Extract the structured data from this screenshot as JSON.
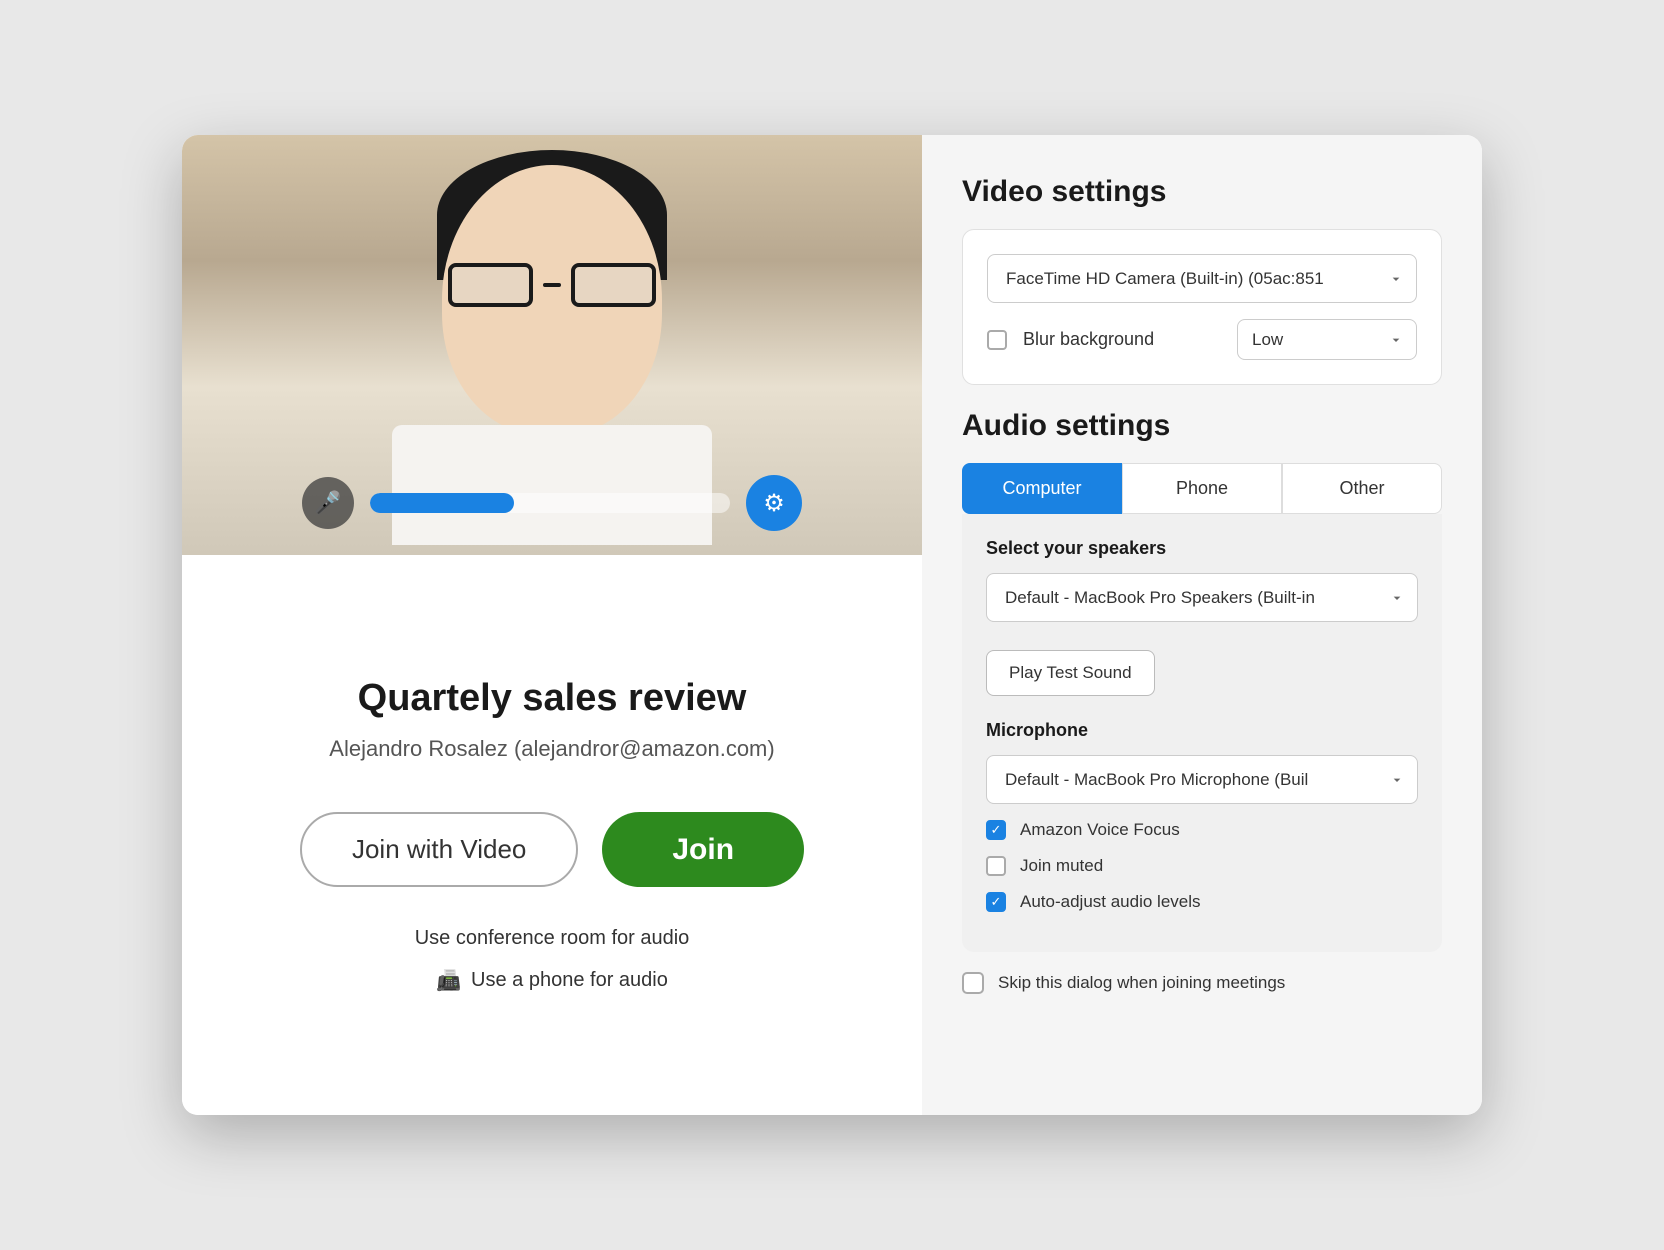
{
  "modal": {
    "left": {
      "meeting_title": "Quartely sales review",
      "meeting_user": "Alejandro Rosalez (alejandror@amazon.com)",
      "join_video_label": "Join with Video",
      "join_label": "Join",
      "conference_room_label": "Use conference room for audio",
      "phone_audio_label": "Use a phone for audio",
      "audio_bar_width": "40%"
    },
    "right": {
      "video_settings_title": "Video settings",
      "camera_select_value": "FaceTime HD Camera (Built-in) (05ac:851",
      "blur_background_label": "Blur background",
      "blur_level_value": "Low",
      "blur_checked": false,
      "audio_settings_title": "Audio settings",
      "tabs": [
        {
          "label": "Computer",
          "active": true
        },
        {
          "label": "Phone",
          "active": false
        },
        {
          "label": "Other",
          "active": false
        }
      ],
      "speakers_label": "Select your speakers",
      "speakers_select_value": "Default - MacBook Pro Speakers (Built-in",
      "play_test_sound_label": "Play Test Sound",
      "microphone_label": "Microphone",
      "microphone_select_value": "Default - MacBook Pro Microphone (Buil‌",
      "amazon_voice_focus_label": "Amazon Voice Focus",
      "amazon_voice_focus_checked": true,
      "join_muted_label": "Join muted",
      "join_muted_checked": false,
      "auto_adjust_label": "Auto-adjust audio levels",
      "auto_adjust_checked": true,
      "skip_dialog_label": "Skip this dialog when joining meetings",
      "skip_dialog_checked": false
    }
  }
}
